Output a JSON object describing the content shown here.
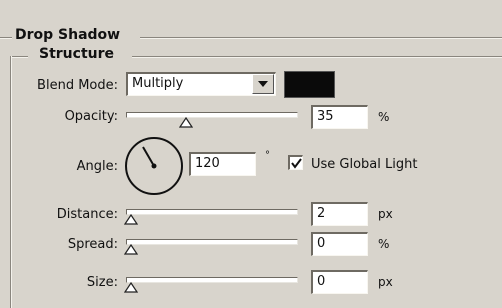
{
  "panel": {
    "title": "Drop Shadow",
    "section_title": "Structure"
  },
  "blend_mode": {
    "label": "Blend Mode:",
    "value": "Multiply",
    "color": "#0a0a0a"
  },
  "opacity": {
    "label": "Opacity:",
    "value": "35",
    "unit": "%",
    "slider_fraction": 0.35
  },
  "angle": {
    "label": "Angle:",
    "value": "120",
    "unit": "°",
    "degrees": 120,
    "global_light_label": "Use Global Light",
    "global_light_checked": true
  },
  "distance": {
    "label": "Distance:",
    "value": "2",
    "unit": "px",
    "slider_fraction": 0.0
  },
  "spread": {
    "label": "Spread:",
    "value": "0",
    "unit": "%",
    "slider_fraction": 0.0
  },
  "size": {
    "label": "Size:",
    "value": "0",
    "unit": "px",
    "slider_fraction": 0.0
  },
  "icons": {
    "dropdown": "chevron-down-icon",
    "slider_thumb": "triangle-thumb-icon",
    "checkmark": "checkmark-icon"
  }
}
